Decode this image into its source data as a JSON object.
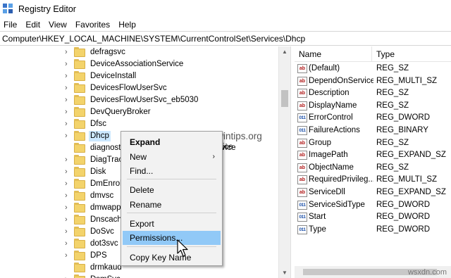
{
  "window": {
    "title": "Registry Editor",
    "icon": "registry-icon"
  },
  "menu": [
    "File",
    "Edit",
    "View",
    "Favorites",
    "Help"
  ],
  "address": "Computer\\HKEY_LOCAL_MACHINE\\SYSTEM\\CurrentControlSet\\Services\\Dhcp",
  "tree": {
    "items": [
      {
        "label": "defragsvc",
        "expand": true
      },
      {
        "label": "DeviceAssociationService",
        "expand": true
      },
      {
        "label": "DeviceInstall",
        "expand": true
      },
      {
        "label": "DevicesFlowUserSvc",
        "expand": true
      },
      {
        "label": "DevicesFlowUserSvc_eb5030",
        "expand": true
      },
      {
        "label": "DevQueryBroker",
        "expand": true
      },
      {
        "label": "Dfsc",
        "expand": true
      },
      {
        "label": "Dhcp",
        "expand": true,
        "selected": true
      },
      {
        "label": "diagnosticshub.standardcollector.service",
        "expand": false
      },
      {
        "label": "DiagTrack",
        "expand": true
      },
      {
        "label": "Disk",
        "expand": true
      },
      {
        "label": "DmEnrollmentSvc",
        "expand": true
      },
      {
        "label": "dmvsc",
        "expand": true
      },
      {
        "label": "dmwappushservice",
        "expand": true
      },
      {
        "label": "Dnscache",
        "expand": true
      },
      {
        "label": "DoSvc",
        "expand": true
      },
      {
        "label": "dot3svc",
        "expand": true
      },
      {
        "label": "DPS",
        "expand": true
      },
      {
        "label": "drmkaud",
        "expand": false
      },
      {
        "label": "DsmSvc",
        "expand": true
      }
    ]
  },
  "values": {
    "col_name": "Name",
    "col_type": "Type",
    "rows": [
      {
        "name": "(Default)",
        "type": "REG_SZ",
        "icon": "ab"
      },
      {
        "name": "DependOnService",
        "type": "REG_MULTI_SZ",
        "icon": "ab"
      },
      {
        "name": "Description",
        "type": "REG_SZ",
        "icon": "ab"
      },
      {
        "name": "DisplayName",
        "type": "REG_SZ",
        "icon": "ab"
      },
      {
        "name": "ErrorControl",
        "type": "REG_DWORD",
        "icon": "bin"
      },
      {
        "name": "FailureActions",
        "type": "REG_BINARY",
        "icon": "bin"
      },
      {
        "name": "Group",
        "type": "REG_SZ",
        "icon": "ab"
      },
      {
        "name": "ImagePath",
        "type": "REG_EXPAND_SZ",
        "icon": "ab"
      },
      {
        "name": "ObjectName",
        "type": "REG_SZ",
        "icon": "ab"
      },
      {
        "name": "RequiredPrivileg...",
        "type": "REG_MULTI_SZ",
        "icon": "ab"
      },
      {
        "name": "ServiceDll",
        "type": "REG_EXPAND_SZ",
        "icon": "ab"
      },
      {
        "name": "ServiceSidType",
        "type": "REG_DWORD",
        "icon": "bin"
      },
      {
        "name": "Start",
        "type": "REG_DWORD",
        "icon": "bin"
      },
      {
        "name": "Type",
        "type": "REG_DWORD",
        "icon": "bin"
      }
    ]
  },
  "context_menu": {
    "items": [
      {
        "label": "Expand",
        "bold": true
      },
      {
        "label": "New",
        "submenu": true
      },
      {
        "label": "Find..."
      },
      {
        "label": "Delete"
      },
      {
        "label": "Rename"
      },
      {
        "label": "Export"
      },
      {
        "label": "Permissions...",
        "highlight": true
      },
      {
        "label": "Copy Key Name"
      }
    ],
    "overflow_text": "ice"
  },
  "watermark": "www.wintips.org",
  "site_mark": "wsxdn.com",
  "colors": {
    "selection": "#cce8ff",
    "menu_highlight": "#91c9f7",
    "folder": "#f3d36b"
  }
}
